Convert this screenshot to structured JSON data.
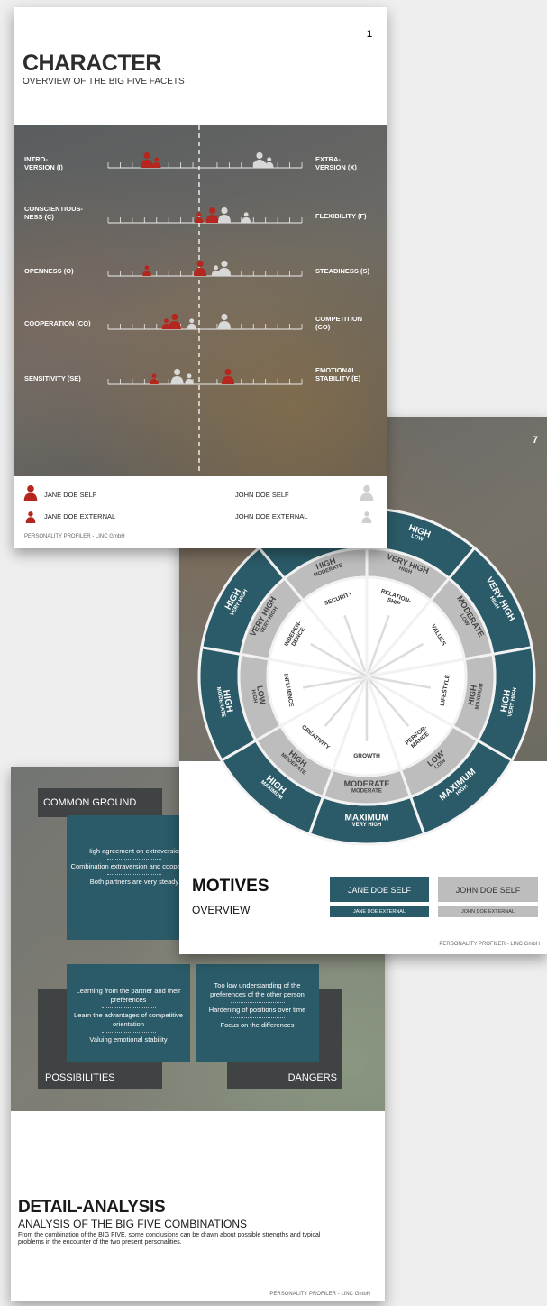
{
  "detail_page": {
    "common_ground_label": "COMMON GROUND",
    "common_ground_items": [
      "High agreement on extraversion",
      "Combination extraversion and cooperation",
      "Both partners are very steady"
    ],
    "possibilities_label": "POSSIBILITIES",
    "possibilities_items": [
      "Learning from the partner and their preferences",
      "Learn the advantages of competitive orientation",
      "Valuing emotional stability"
    ],
    "dangers_label": "DANGERS",
    "dangers_items": [
      "Too low understanding of the preferences of the other person",
      "Hardening of positions over time",
      "Focus on the differences"
    ],
    "title": "DETAIL-ANALYSIS",
    "subtitle": "ANALYSIS OF THE BIG FIVE COMBINATIONS",
    "description": "From the combination of the BIG FIVE, some conclusions can be drawn about possible strengths and typical problems in the encounter of the two present personalities.",
    "footer": "PERSONALITY PROFILER - LINC GmbH"
  },
  "character_page": {
    "page_number": "1",
    "title": "CHARACTER",
    "subtitle": "OVERVIEW OF THE BIG FIVE FACETS",
    "facets": [
      {
        "left": "INTRO-\nVERSION (I)",
        "right": "EXTRA-\nVERSION (X)",
        "jane_self": 3.2,
        "jane_ext": 4.0,
        "john_self": 12.5,
        "john_ext": 13.3
      },
      {
        "left": "CONSCIENTIOUS-\nNESS (C)",
        "right": "FLEXIBILITY (F)",
        "jane_self": 8.6,
        "jane_ext": 7.5,
        "john_self": 9.6,
        "john_ext": 11.4
      },
      {
        "left": "OPENNESS (O)",
        "right": "STEADINESS (S)",
        "jane_self": 7.6,
        "jane_ext": 3.2,
        "john_self": 9.6,
        "john_ext": 8.9
      },
      {
        "left": "COOPERATION (CO)",
        "right": "COMPETITION\n(CO)",
        "jane_self": 5.5,
        "jane_ext": 4.8,
        "john_self": 9.6,
        "john_ext": 6.9
      },
      {
        "left": "SENSITIVITY (SE)",
        "right": "EMOTIONAL\nSTABILITY (E)",
        "jane_self": 9.9,
        "jane_ext": 3.8,
        "john_self": 5.7,
        "john_ext": 6.7
      }
    ],
    "legend_jane_self": "JANE DOE SELF",
    "legend_jane_external": "JANE DOE EXTERNAL",
    "legend_john_self": "JOHN DOE SELF",
    "legend_john_external": "JOHN DOE EXTERNAL",
    "footer": "PERSONALITY PROFILER - LINC GmbH",
    "colors": {
      "jane": "#b5261e",
      "john": "#d8d8d8"
    }
  },
  "motives_page": {
    "page_number": "7",
    "title": "MOTIVES",
    "subtitle": "OVERVIEW",
    "legend_jane_self": "JANE DOE SELF",
    "legend_jane_external": "JANE DOE EXTERNAL",
    "legend_john_self": "JOHN DOE SELF",
    "legend_john_external": "JOHN DOE EXTERNAL",
    "footer": "PERSONALITY PROFILER - LINC GmbH",
    "colors": {
      "teal": "#2b5b68",
      "grey": "#bdbdbd"
    },
    "motives": [
      {
        "name": "SECURITY",
        "inner_big": "HIGH",
        "inner_small": "MODERATE",
        "outer_big": "MODERATE",
        "outer_small": "MODERATE"
      },
      {
        "name": "RELATION-\nSHIP",
        "inner_big": "VERY HIGH",
        "inner_small": "HIGH",
        "outer_big": "HIGH",
        "outer_small": "LOW"
      },
      {
        "name": "VALUES",
        "inner_big": "MODERATE",
        "inner_small": "LOW",
        "outer_big": "VERY HIGH",
        "outer_small": "HIGH"
      },
      {
        "name": "LIFESTYLE",
        "inner_big": "HIGH",
        "inner_small": "MAXIMUM",
        "outer_big": "HIGH",
        "outer_small": "VERY HIGH"
      },
      {
        "name": "PERFOR-\nMANCE",
        "inner_big": "LOW",
        "inner_small": "LOW",
        "outer_big": "MAXIMUM",
        "outer_small": "HIGH"
      },
      {
        "name": "GROWTH",
        "inner_big": "MODERATE",
        "inner_small": "MODERATE",
        "outer_big": "MAXIMUM",
        "outer_small": "VERY HIGH"
      },
      {
        "name": "CREATIVITY",
        "inner_big": "HIGH",
        "inner_small": "MODERATE",
        "outer_big": "HIGH",
        "outer_small": "MAXIMUM"
      },
      {
        "name": "INFLUENCE",
        "inner_big": "LOW",
        "inner_small": "HIGH",
        "outer_big": "HIGH",
        "outer_small": "MODERATE"
      },
      {
        "name": "INDEPEN-\nDENCE",
        "inner_big": "VERY HIGH",
        "inner_small": "VERY HIGH",
        "outer_big": "HIGH",
        "outer_small": "VERY HIGH"
      }
    ]
  }
}
